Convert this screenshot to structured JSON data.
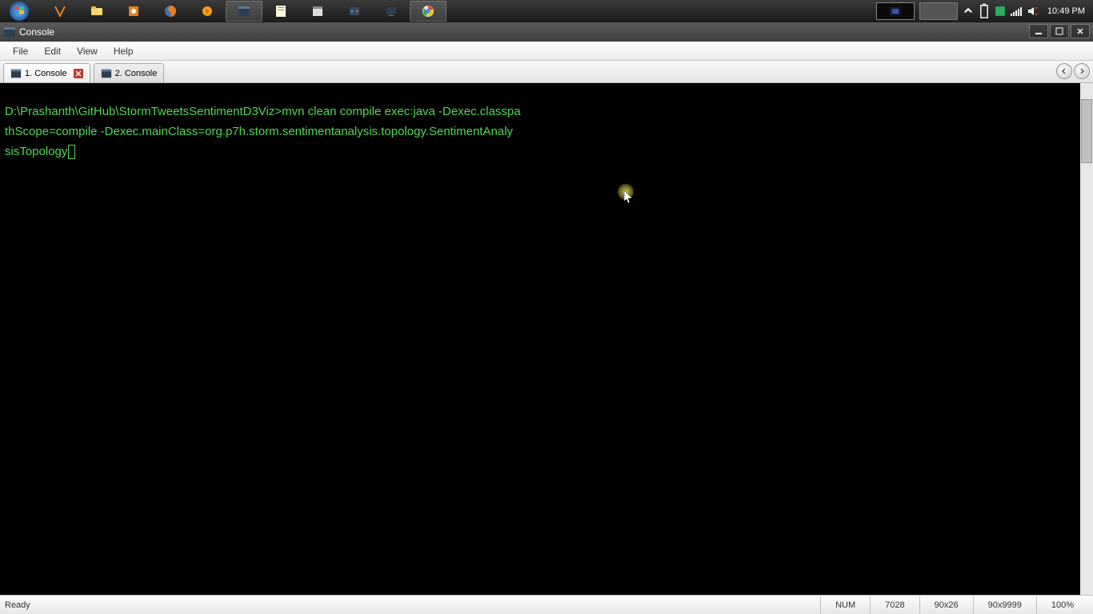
{
  "taskbar": {
    "clock": "10:49 PM"
  },
  "window": {
    "title": "Console"
  },
  "menu": {
    "items": [
      "File",
      "Edit",
      "View",
      "Help"
    ]
  },
  "tabs": [
    {
      "label": "1. Console",
      "active": true
    },
    {
      "label": "2. Console",
      "active": false
    }
  ],
  "terminal": {
    "line1": "D:\\Prashanth\\GitHub\\StormTweetsSentimentD3Viz>mvn clean compile exec:java -Dexec.classpa",
    "line2": "thScope=compile -Dexec.mainClass=org.p7h.storm.sentimentanalysis.topology.SentimentAnaly",
    "line3": "sisTopology"
  },
  "statusbar": {
    "ready": "Ready",
    "num": "NUM",
    "pid": "7028",
    "dims": "90x26",
    "buf": "90x9999",
    "zoom": "100%"
  }
}
